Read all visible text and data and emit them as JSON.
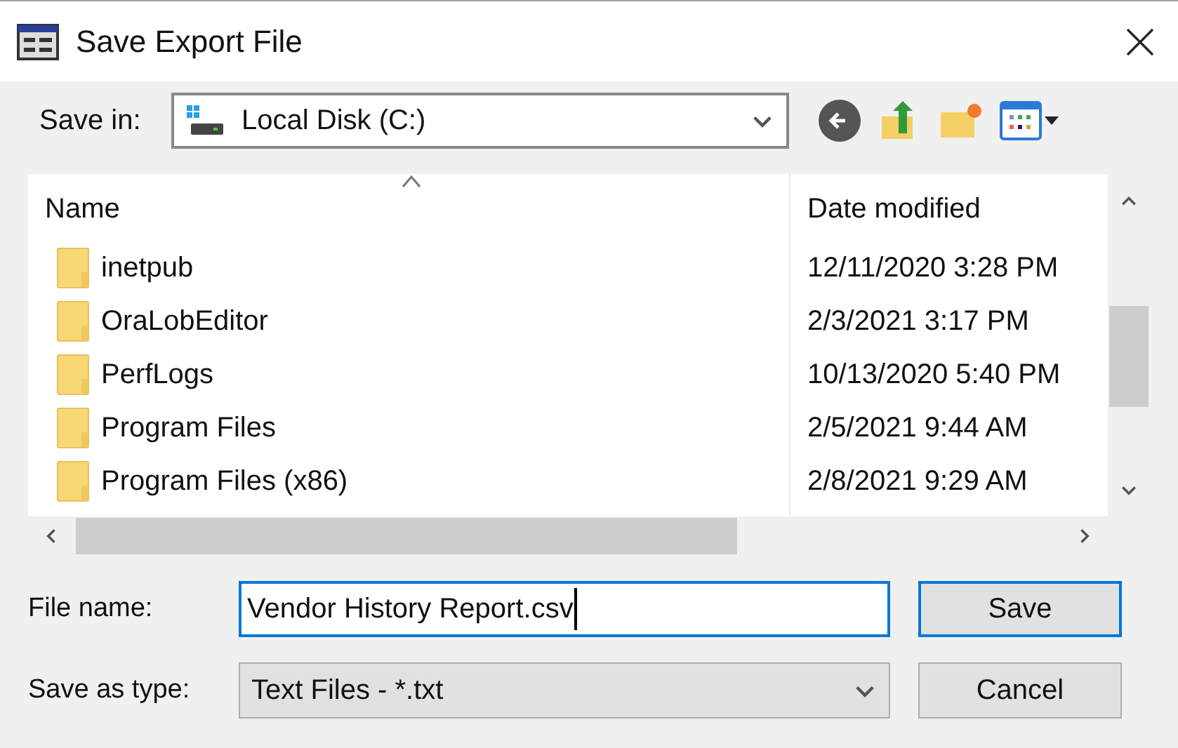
{
  "window": {
    "title": "Save Export File"
  },
  "save_in": {
    "label": "Save in:",
    "value": "Local Disk (C:)"
  },
  "columns": [
    "Name",
    "Date modified"
  ],
  "rows": [
    {
      "name": "inetpub",
      "date": "12/11/2020 3:28 PM"
    },
    {
      "name": "OraLobEditor",
      "date": "2/3/2021 3:17 PM"
    },
    {
      "name": "PerfLogs",
      "date": "10/13/2020 5:40 PM"
    },
    {
      "name": "Program Files",
      "date": "2/5/2021 9:44 AM"
    },
    {
      "name": "Program Files (x86)",
      "date": "2/8/2021 9:29 AM"
    }
  ],
  "file_name": {
    "label": "File name:",
    "value": "Vendor History Report.csv"
  },
  "save_as_type": {
    "label": "Save as type:",
    "value": "Text Files - *.txt"
  },
  "buttons": [
    {
      "label": "Save",
      "default": true
    },
    {
      "label": "Cancel",
      "default": false
    }
  ]
}
